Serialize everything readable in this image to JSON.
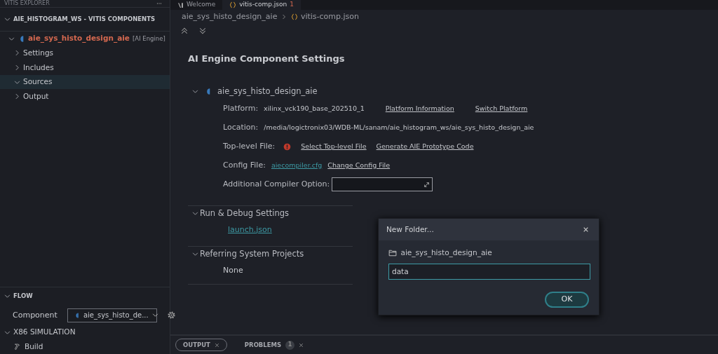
{
  "explorer": {
    "title": "VITIS EXPLORER",
    "section": {
      "label": "AIE_HISTOGRAM_WS - VITIS COMPONENTS",
      "expanded": true
    },
    "tree": [
      {
        "label": "aie_sys_histo_design_aie",
        "tag": "[AI Engine]",
        "expanded": true,
        "selected": false,
        "children": [
          {
            "label": "Settings",
            "expanded": false,
            "selected": false
          },
          {
            "label": "Includes",
            "expanded": false,
            "selected": false
          },
          {
            "label": "Sources",
            "expanded": true,
            "selected": true
          },
          {
            "label": "Output",
            "expanded": false,
            "selected": false
          }
        ]
      }
    ]
  },
  "flow": {
    "title": "FLOW",
    "expanded": true,
    "component_label": "Component",
    "component_value": "aie_sys_histo_de...",
    "sections": [
      {
        "label": "X86 SIMULATION",
        "expanded": true,
        "items": [
          {
            "label": "Build"
          }
        ]
      }
    ]
  },
  "editor_tabs": [
    {
      "label": "Welcome",
      "selected": false
    },
    {
      "label": "vitis-comp.json",
      "badge": "1",
      "selected": true
    }
  ],
  "breadcrumb": [
    "aie_sys_histo_design_aie",
    "vitis-comp.json"
  ],
  "settings": {
    "title": "AI Engine Component Settings",
    "component": {
      "name": "aie_sys_histo_design_aie",
      "expanded": true
    },
    "rows": [
      {
        "kind": "info",
        "label": "Platform:",
        "value": "xilinx_vck190_base_202510_1",
        "links": [
          "Platform Information",
          "Switch Platform"
        ]
      },
      {
        "kind": "info",
        "label": "Location:",
        "value": "/media/logictronix03/WDB-ML/sanam/aie_histogram_ws/aie_sys_histo_design_aie",
        "links": []
      },
      {
        "kind": "info",
        "label": "Top-level File:",
        "error": true,
        "links": [
          "Select Top-level File",
          "Generate AIE Prototype Code"
        ]
      },
      {
        "kind": "info",
        "label": "Config File:",
        "file": "aiecompiler.cfg",
        "links": [
          "Change Config File"
        ]
      },
      {
        "kind": "field",
        "label": "Additional Compiler Option:"
      }
    ],
    "sections": [
      {
        "title": "Run & Debug Settings",
        "expanded": true,
        "items": [
          {
            "kind": "file",
            "text": "launch.json"
          }
        ]
      },
      {
        "title": "Referring System Projects",
        "expanded": true,
        "items": [
          {
            "kind": "text",
            "text": "None"
          }
        ]
      }
    ]
  },
  "dialog": {
    "title": "New Folder...",
    "path": "aie_sys_histo_design_aie",
    "value": "data",
    "button": "OK"
  },
  "panel_tabs": [
    {
      "label": "OUTPUT",
      "selected": true
    },
    {
      "label": "PROBLEMS",
      "badge": "1",
      "selected": false
    }
  ]
}
